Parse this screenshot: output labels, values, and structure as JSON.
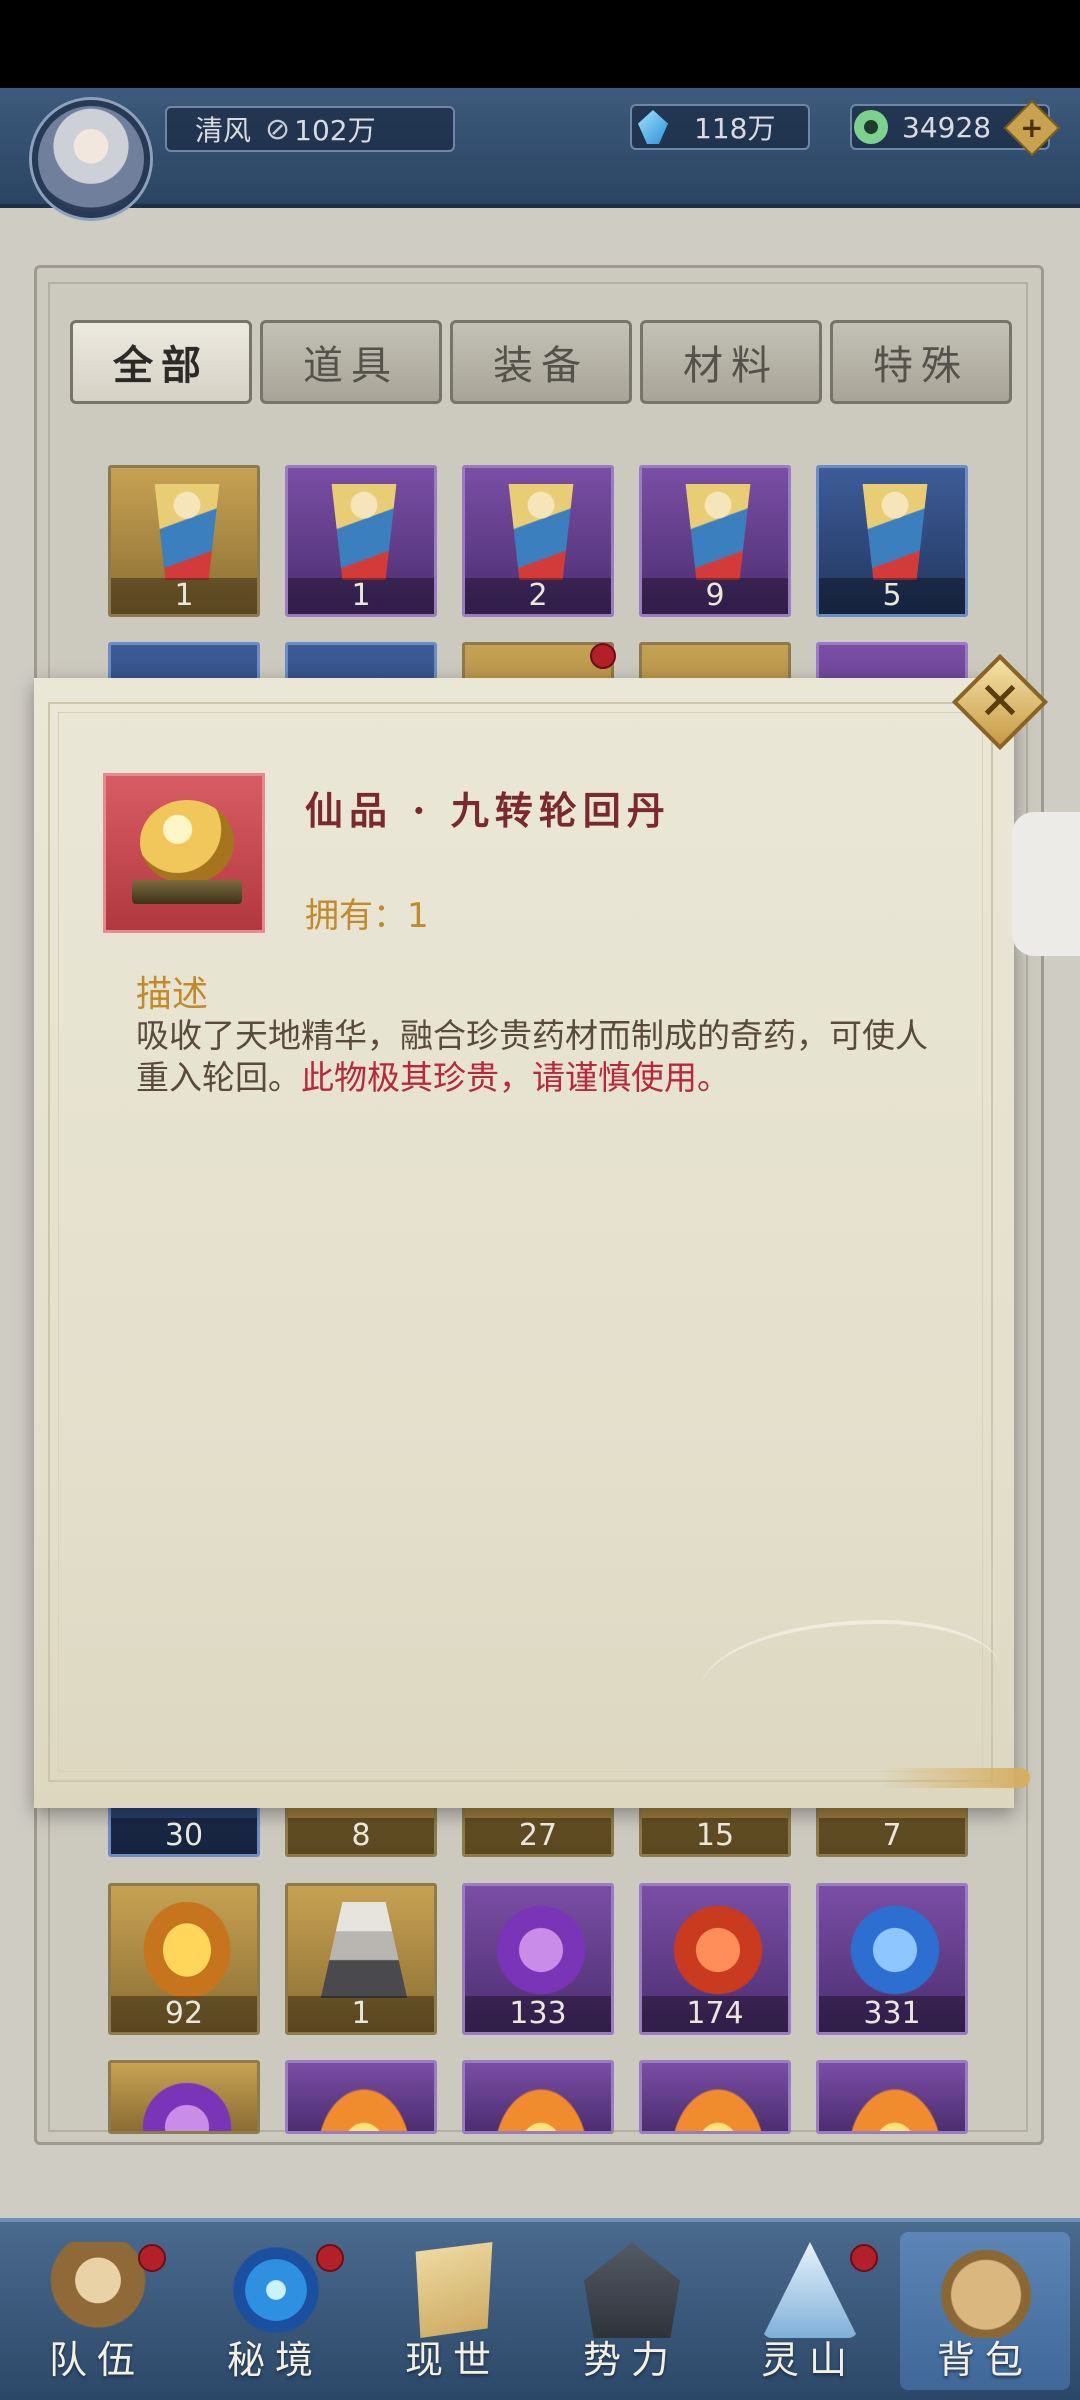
{
  "header": {
    "player_name": "清风",
    "power_value": "102万",
    "crystals": "118万",
    "jade": "34928"
  },
  "tabs": [
    {
      "label": "全部",
      "active": true
    },
    {
      "label": "道具",
      "active": false
    },
    {
      "label": "装备",
      "active": false
    },
    {
      "label": "材料",
      "active": false
    },
    {
      "label": "特殊",
      "active": false
    }
  ],
  "grid": {
    "row1": [
      "1",
      "1",
      "2",
      "9",
      "5"
    ],
    "row_hidden_bottom": [
      "30",
      "8",
      "27",
      "15",
      "7"
    ],
    "row3": [
      "92",
      "1",
      "133",
      "174",
      "331"
    ]
  },
  "popup": {
    "item_name": "仙品 · 九转轮回丹",
    "owned_label": "拥有：",
    "owned_count": "1",
    "desc_label": "描述",
    "desc_text": "吸收了天地精华，融合珍贵药材而制成的奇药，可使人重入轮回。",
    "desc_warning": "此物极其珍贵，请谨慎使用。"
  },
  "nav": [
    {
      "label": "队伍",
      "icon": "team-icon",
      "dot": true
    },
    {
      "label": "秘境",
      "icon": "realm-icon",
      "dot": true
    },
    {
      "label": "现世",
      "icon": "world-icon",
      "dot": false
    },
    {
      "label": "势力",
      "icon": "faction-icon",
      "dot": false
    },
    {
      "label": "灵山",
      "icon": "mountain-icon",
      "dot": true
    },
    {
      "label": "背包",
      "icon": "bag-icon",
      "dot": false
    }
  ],
  "colors": {
    "accent_gold": "#c28a2b",
    "item_name": "#7a2a2e",
    "warning_red": "#b9283a",
    "nav_bg": "#2c4868"
  }
}
